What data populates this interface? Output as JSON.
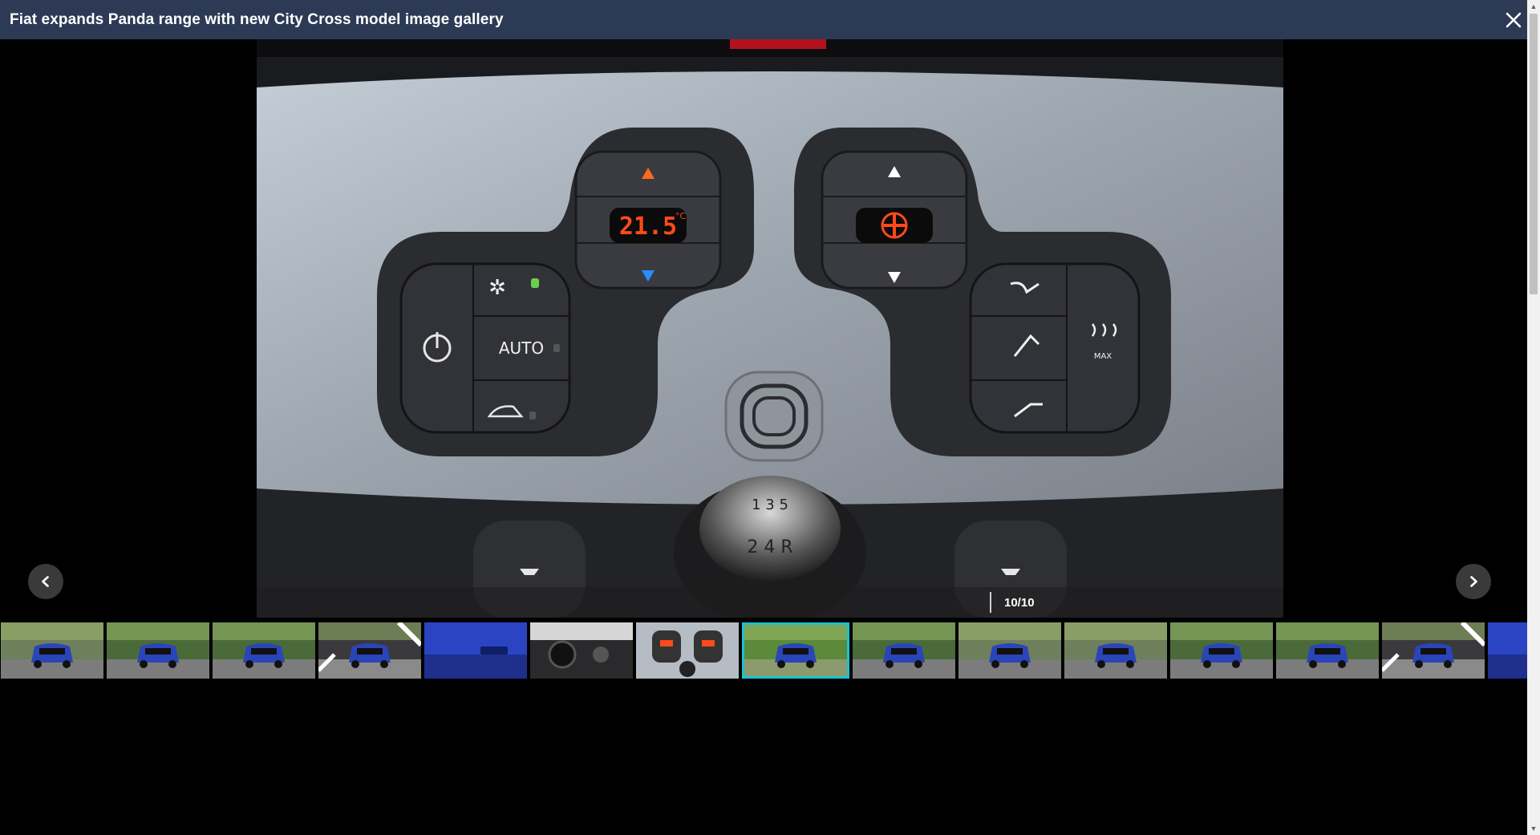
{
  "gallery": {
    "title": "Fiat expands Panda range with new City Cross model image gallery",
    "counter": "10/10",
    "main_image": {
      "display_temperature": "21.5",
      "temperature_unit": "°C",
      "auto_label": "AUTO",
      "max_label": "MAX",
      "gear_labels": [
        "1",
        "3",
        "5",
        "2",
        "4",
        "R"
      ]
    },
    "thumbnails": [
      {
        "scene": "blue-suv-front-road"
      },
      {
        "scene": "blue-suv-front-trees"
      },
      {
        "scene": "blue-suv-rear-trees"
      },
      {
        "scene": "blue-suv-front-stripes"
      },
      {
        "scene": "blue-door-badge"
      },
      {
        "scene": "dashboard-interior"
      },
      {
        "scene": "climate-control-panel"
      },
      {
        "scene": "blue-suv-front-park",
        "active": true
      },
      {
        "scene": "blue-suv-rear-trees"
      },
      {
        "scene": "blue-suv-front-road"
      },
      {
        "scene": "blue-suv-front-road"
      },
      {
        "scene": "blue-suv-front-trees"
      },
      {
        "scene": "blue-suv-rear-trees"
      },
      {
        "scene": "blue-suv-front-stripes"
      },
      {
        "scene": "blue-door-badge"
      }
    ],
    "colors": {
      "header_bg": "#2d3a55",
      "active_thumb_border": "#19c3d6",
      "display_digits": "#ff4a1a"
    }
  }
}
